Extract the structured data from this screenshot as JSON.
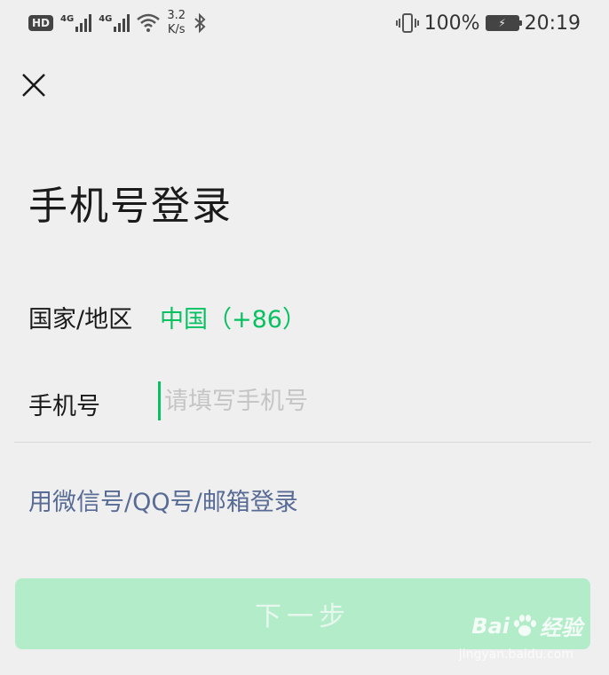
{
  "status_bar": {
    "hd": "HD",
    "sim1_gen": "4G",
    "sim2_gen": "4G",
    "speed_value": "3.2",
    "speed_unit": "K/s",
    "battery_percent": "100%",
    "time": "20:19",
    "icons": [
      "wifi-icon",
      "bluetooth-icon",
      "vibrate-icon",
      "battery-charging-icon"
    ]
  },
  "header": {
    "close_icon": "close-icon"
  },
  "main": {
    "title": "手机号登录",
    "country_label": "国家/地区",
    "country_value": "中国（+86）",
    "phone_label": "手机号",
    "phone_placeholder": "请填写手机号",
    "phone_value": "",
    "alt_login": "用微信号/QQ号/邮箱登录",
    "next_button": "下一步"
  },
  "watermark": {
    "brand_left": "Bai",
    "brand_right": "经验",
    "url": "jingyan.baidu.com"
  },
  "colors": {
    "accent": "#07c160",
    "link": "#576b95",
    "button_disabled_bg": "#b2ecc9",
    "background": "#efefef"
  }
}
